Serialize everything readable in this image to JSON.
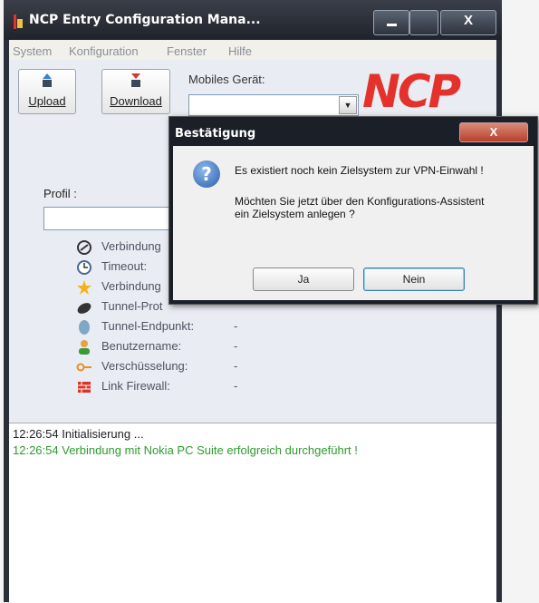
{
  "window": {
    "title": "NCP Entry Configuration Mana...",
    "close_symbol": "X"
  },
  "menu": [
    "System",
    "Konfiguration",
    "Fenster",
    "Hilfe"
  ],
  "toolbar": {
    "upload_label": "Upload",
    "download_label": "Download",
    "mobile_device_label": "Mobiles Gerät:",
    "logo_text": "NCP",
    "accent_color": "#e4312b"
  },
  "profile": {
    "label": "Profil :"
  },
  "info_rows": [
    {
      "label": "Verbindung",
      "icon": "connection-icon",
      "value": ""
    },
    {
      "label": "Timeout:",
      "icon": "clock-icon",
      "value": ""
    },
    {
      "label": "Verbindung",
      "icon": "star-icon",
      "value": ""
    },
    {
      "label": "Tunnel-Prot",
      "icon": "tunnel-protocol-icon",
      "value": ""
    },
    {
      "label": "Tunnel-Endpunkt:",
      "icon": "tunnel-endpoint-icon",
      "value": "-"
    },
    {
      "label": "Benutzername:",
      "icon": "user-icon",
      "value": "-"
    },
    {
      "label": "Verschüsselung:",
      "icon": "key-icon",
      "value": "-"
    },
    {
      "label": "Link Firewall:",
      "icon": "firewall-icon",
      "value": "-"
    }
  ],
  "log": [
    {
      "time": "12:26:54",
      "text": "Initialisierung ...",
      "color": "#222222"
    },
    {
      "time": "12:26:54",
      "text": "Verbindung mit Nokia PC Suite erfolgreich durchgeführt !",
      "color": "#2e9a2e"
    }
  ],
  "dialog": {
    "title": "Bestätigung",
    "message_line1": "Es existiert noch kein Zielsystem zur VPN-Einwahl !",
    "message_line2": "Möchten Sie jetzt über den Konfigurations-Assistent",
    "message_line3": "ein Zielsystem anlegen ?",
    "yes_label": "Ja",
    "no_label": "Nein",
    "close_symbol": "X"
  }
}
